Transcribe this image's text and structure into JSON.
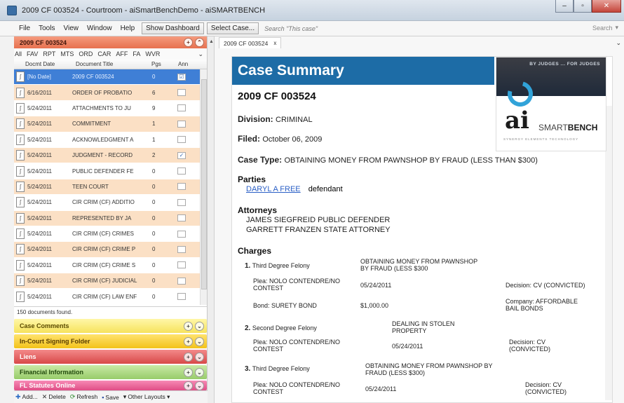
{
  "window": {
    "title": "2009 CF 003524 - Courtroom - aiSmartBenchDemo - aiSMARTBENCH",
    "min": "–",
    "max": "▫",
    "close": "✕"
  },
  "menu": {
    "file": "File",
    "tools": "Tools",
    "view": "View",
    "window": "Window",
    "help": "Help",
    "show_dashboard": "Show Dashboard",
    "select_case": "Select Case...",
    "search_case": "Search \"This case\"",
    "search": "Search"
  },
  "left_panel": {
    "case_header": "2009 CF 003524",
    "filters": [
      "All",
      "FAV",
      "RPT",
      "MTS",
      "ORD",
      "CAR",
      "AFF",
      "FA",
      "WVR"
    ],
    "columns": {
      "date": "Docmt Date",
      "title": "Document Title",
      "pgs": "Pgs",
      "ann": "Ann"
    },
    "rows": [
      {
        "date": "[No Date]",
        "title": "2009 CF 003524",
        "pgs": "0",
        "ann": "☑",
        "style": "selected"
      },
      {
        "date": "6/16/2011",
        "title": "ORDER OF PROBATIO",
        "pgs": "6",
        "ann": "",
        "style": "orange"
      },
      {
        "date": "5/24/2011",
        "title": "ATTACHMENTS TO JU",
        "pgs": "9",
        "ann": "",
        "style": "white"
      },
      {
        "date": "5/24/2011",
        "title": "COMMITMENT",
        "pgs": "1",
        "ann": "",
        "style": "orange"
      },
      {
        "date": "5/24/2011",
        "title": "ACKNOWLEDGMENT A",
        "pgs": "1",
        "ann": "",
        "style": "white"
      },
      {
        "date": "5/24/2011",
        "title": "JUDGMENT - RECORD",
        "pgs": "2",
        "ann": "✓",
        "style": "orange"
      },
      {
        "date": "5/24/2011",
        "title": "PUBLIC DEFENDER FE",
        "pgs": "0",
        "ann": "",
        "style": "white"
      },
      {
        "date": "5/24/2011",
        "title": "TEEN COURT",
        "pgs": "0",
        "ann": "",
        "style": "orange"
      },
      {
        "date": "5/24/2011",
        "title": "CIR CRIM (CF) ADDITIO",
        "pgs": "0",
        "ann": "",
        "style": "white"
      },
      {
        "date": "5/24/2011",
        "title": "REPRESENTED BY JA",
        "pgs": "0",
        "ann": "",
        "style": "orange"
      },
      {
        "date": "5/24/2011",
        "title": "CIR CRIM (CF) CRIMES",
        "pgs": "0",
        "ann": "",
        "style": "white"
      },
      {
        "date": "5/24/2011",
        "title": "CIR CRIM (CF) CRIME P",
        "pgs": "0",
        "ann": "",
        "style": "orange"
      },
      {
        "date": "5/24/2011",
        "title": "CIR CRIM (CF) CRIME S",
        "pgs": "0",
        "ann": "",
        "style": "white"
      },
      {
        "date": "5/24/2011",
        "title": "CIR CRIM (CF) JUDICIAL",
        "pgs": "0",
        "ann": "",
        "style": "orange"
      },
      {
        "date": "5/24/2011",
        "title": "CIR CRIM (CF) LAW ENF",
        "pgs": "0",
        "ann": "",
        "style": "white"
      }
    ],
    "count": "150 documents found.",
    "sections": [
      {
        "label": "Case Comments",
        "style": "s-yellow"
      },
      {
        "label": "In-Court Signing Folder",
        "style": "s-amber"
      },
      {
        "label": "Liens",
        "style": "s-red"
      },
      {
        "label": "Financial Information",
        "style": "s-green"
      },
      {
        "label": "FL Statutes Online",
        "style": "s-pink"
      }
    ],
    "toolbar": {
      "add": "Add...",
      "delete": "Delete",
      "refresh": "Refresh",
      "save": "Save",
      "other": "Other Layouts"
    }
  },
  "tab": {
    "label": "2009 CF 003524",
    "close": "x"
  },
  "summary": {
    "heading": "Case Summary",
    "case_no": "2009 CF 003524",
    "division_label": "Division:",
    "division": "CRIMINAL",
    "filed_label": "Filed:",
    "filed": "October 06, 2009",
    "case_type_label": "Case Type:",
    "case_type": "OBTAINING MONEY FROM PAWNSHOP BY FRAUD (LESS THAN $300)",
    "parties_label": "Parties",
    "party_name": "DARYL A FREE",
    "party_role": "defendant",
    "attorneys_label": "Attorneys",
    "attorneys": [
      "JAMES SIEGFREID PUBLIC DEFENDER",
      "GARRETT FRANZEN STATE ATTORNEY"
    ],
    "charges_label": "Charges",
    "charges": [
      {
        "num": "1.",
        "degree": "Third Degree Felony",
        "desc1": "OBTAINING MONEY FROM PAWNSHOP",
        "desc2": "BY FRAUD (LESS $300",
        "plea1": "Plea: NOLO CONTENDRE/NO",
        "plea2": "CONTEST",
        "date": "05/24/2011",
        "decision": "Decision: CV (CONVICTED)",
        "bond": "Bond: SURETY BOND",
        "amount": "$1,000.00",
        "company1": "Company: AFFORDABLE",
        "company2": "BAIL BONDS"
      },
      {
        "num": "2.",
        "degree": "Second Degree Felony",
        "desc1": "DEALING IN STOLEN",
        "desc2": "PROPERTY",
        "plea1": "Plea: NOLO CONTENDRE/NO",
        "plea2": "CONTEST",
        "date": "05/24/2011",
        "decision1": "Decision: CV",
        "decision2": "(CONVICTED)"
      },
      {
        "num": "3.",
        "degree": "Third Degree Felony",
        "desc1": "OBTAINING MONEY FROM PAWNSHOP BY",
        "desc2": "FRAUD (LESS $300)",
        "plea1": "Plea: NOLO CONTENDRE/NO",
        "plea2": "CONTEST",
        "date": "05/24/2011",
        "decision1": "Decision: CV",
        "decision2": "(CONVICTED)"
      }
    ]
  },
  "logo": {
    "tagline": "BY JUDGES ... FOR JUDGES",
    "ai": "ai",
    "smart": "SMART",
    "bench": "BENCH",
    "sub": "SYNERGY ELEMENTS TECHNOLOGY"
  }
}
